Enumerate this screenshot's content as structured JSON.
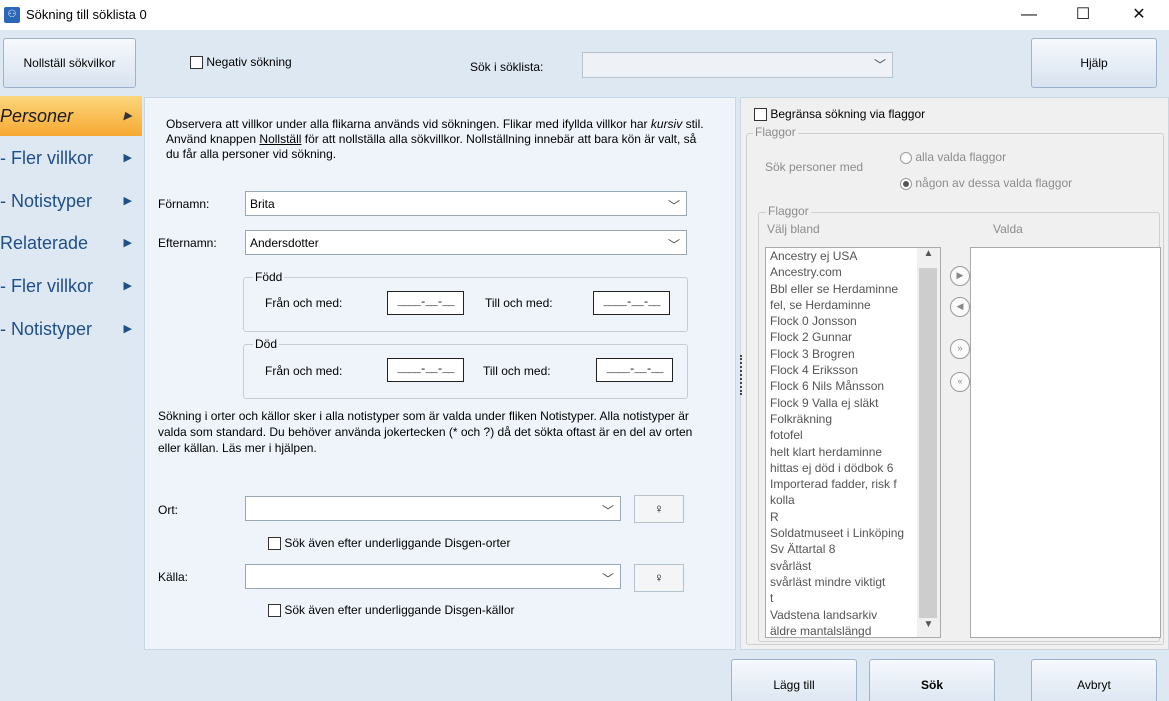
{
  "window": {
    "title": "Sökning till söklista 0",
    "minimize": "—",
    "maximize": "☐",
    "close": "✕"
  },
  "toolbar": {
    "reset_label": "Nollställ sökvilkor",
    "negative_search_label": "Negativ sökning",
    "search_in_label": "Sök i söklista:",
    "search_in_value": "",
    "help_label": "Hjälp"
  },
  "nav": {
    "items": [
      {
        "label": "Personer"
      },
      {
        "label": "- Fler villkor"
      },
      {
        "label": "- Notistyper"
      },
      {
        "label": "Relaterade"
      },
      {
        "label": "- Fler villkor"
      },
      {
        "label": "- Notistyper"
      }
    ]
  },
  "main": {
    "info_1a": "Observera att villkor under alla flikarna används vid sökningen. Flikar med ifyllda villkor har ",
    "info_1_italic": "kursiv",
    "info_1b": " stil. Använd knappen ",
    "info_1_underline": "Nollställ",
    "info_1c": " för att nollställa alla sökvillkor. Nollställning innebär att bara kön är valt, så du får alla personer vid sökning.",
    "firstname_label": "Förnamn:",
    "firstname_value": "Brita",
    "lastname_label": "Efternamn:",
    "lastname_value": "Andersdotter",
    "born_title": "Född",
    "died_title": "Död",
    "from_label": "Från och med:",
    "to_label": "Till och med:",
    "date_placeholder": "____-__-__",
    "info_2": "Sökning i orter och källor sker i alla notistyper som är valda under fliken Notistyper. Alla notistyper är valda som standard. Du behöver använda jokertecken (* och ?) då det sökta oftast är en del av orten eller källan. Läs mer i hjälpen.",
    "place_label": "Ort:",
    "place_value": "",
    "place_sub_label": "Sök även efter underliggande Disgen-orter",
    "source_label": "Källa:",
    "source_value": "",
    "source_sub_label": "Sök även efter underliggande Disgen-källor"
  },
  "flags": {
    "limit_label": "Begränsa sökning via flaggor",
    "group_title": "Flaggor",
    "search_persons_with": "Sök personer med",
    "opt_all": "alla valda flaggor",
    "opt_any": "någon av dessa valda flaggor",
    "list_group_title": "Flaggor",
    "choose_from": "Välj bland",
    "chosen": "Valda",
    "items": [
      "Ancestry ej USA",
      "Ancestry.com",
      "Bbl eller se Herdaminne",
      "fel, se Herdaminne",
      "Flock 0 Jonsson",
      "Flock 2 Gunnar",
      "Flock 3 Brogren",
      "Flock 4 Eriksson",
      "Flock 6 Nils Månsson",
      "Flock 9 Valla ej släkt",
      "Folkräkning",
      "fotofel",
      "helt klart herdaminne",
      "hittas ej död i dödbok 6",
      "Importerad fadder, risk f",
      "kolla",
      "R",
      "Soldatmuseet i Linköping",
      "Sv Ättartal 8",
      "svårläst",
      "svårläst mindre viktigt",
      "t",
      "Vadstena landsarkiv",
      "äldre mantalslängd"
    ]
  },
  "bottom": {
    "add_label": "Lägg till",
    "search_label": "Sök",
    "cancel_label": "Avbryt"
  }
}
